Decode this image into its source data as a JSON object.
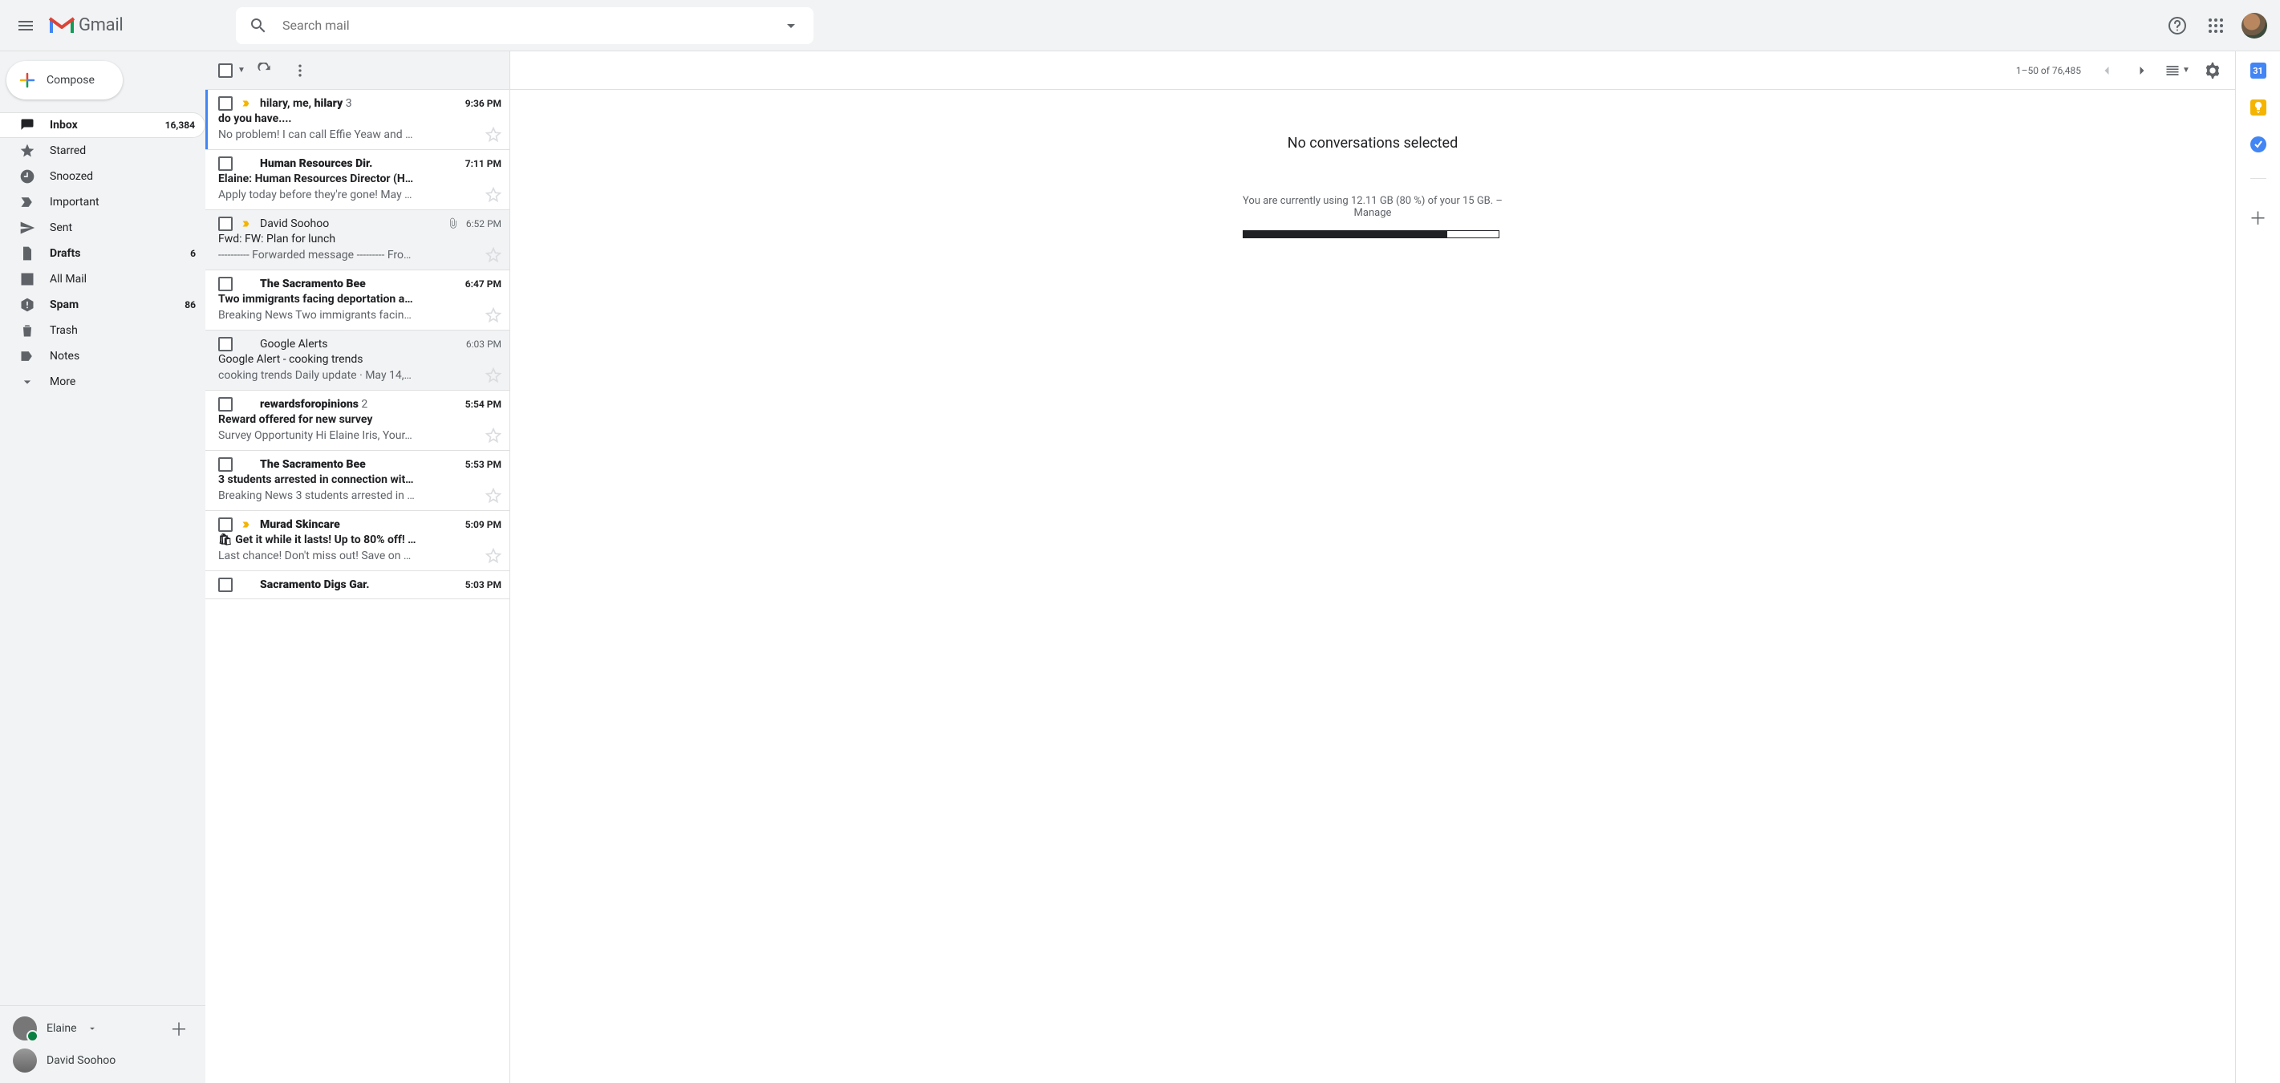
{
  "header": {
    "app_name": "Gmail",
    "search_placeholder": "Search mail"
  },
  "compose_label": "Compose",
  "sidebar": {
    "items": [
      {
        "icon": "inbox",
        "label": "Inbox",
        "count": "16,384",
        "active": true,
        "bold": true
      },
      {
        "icon": "star",
        "label": "Starred",
        "count": "",
        "active": false,
        "bold": false
      },
      {
        "icon": "clock",
        "label": "Snoozed",
        "count": "",
        "active": false,
        "bold": false
      },
      {
        "icon": "important",
        "label": "Important",
        "count": "",
        "active": false,
        "bold": false
      },
      {
        "icon": "send",
        "label": "Sent",
        "count": "",
        "active": false,
        "bold": false
      },
      {
        "icon": "file",
        "label": "Drafts",
        "count": "6",
        "active": false,
        "bold": true
      },
      {
        "icon": "mail",
        "label": "All Mail",
        "count": "",
        "active": false,
        "bold": false
      },
      {
        "icon": "spam",
        "label": "Spam",
        "count": "86",
        "active": false,
        "bold": true
      },
      {
        "icon": "trash",
        "label": "Trash",
        "count": "",
        "active": false,
        "bold": false
      },
      {
        "icon": "label",
        "label": "Notes",
        "count": "",
        "active": false,
        "bold": false
      },
      {
        "icon": "expand",
        "label": "More",
        "count": "",
        "active": false,
        "bold": false
      }
    ]
  },
  "hangouts": {
    "me": "Elaine",
    "contacts": [
      "David Soohoo"
    ]
  },
  "toolbar": {
    "page_info": "1–50 of 76,485"
  },
  "conversations": [
    {
      "unread": true,
      "selected": true,
      "important": true,
      "attachment": false,
      "sender_html": "hilary, me, <b>hilary</b>",
      "thread_count": "3",
      "time": "9:36 PM",
      "subject": "do you have....",
      "snippet": "No problem! I can call Effie Yeaw and …"
    },
    {
      "unread": true,
      "selected": false,
      "important": false,
      "attachment": false,
      "sender_html": "<b>Human Resources Dir.</b>",
      "thread_count": "",
      "time": "7:11 PM",
      "subject": "Elaine: Human Resources Director (H…",
      "snippet": "Apply today before they're gone! May …"
    },
    {
      "unread": false,
      "selected": false,
      "important": true,
      "attachment": true,
      "sender_html": "David Soohoo",
      "thread_count": "",
      "time": "6:52 PM",
      "subject": "Fwd: FW: Plan for lunch",
      "snippet": "---------- Forwarded message --------- Fro…"
    },
    {
      "unread": true,
      "selected": false,
      "important": false,
      "attachment": false,
      "sender_html": "<b>The Sacramento Bee</b>",
      "thread_count": "",
      "time": "6:47 PM",
      "subject": "Two immigrants facing deportation a…",
      "snippet": "Breaking News Two immigrants facin…"
    },
    {
      "unread": false,
      "selected": false,
      "important": false,
      "attachment": false,
      "sender_html": "Google Alerts",
      "thread_count": "",
      "time": "6:03 PM",
      "subject": "Google Alert - cooking trends",
      "snippet": "cooking trends Daily update · May 14,…"
    },
    {
      "unread": true,
      "selected": false,
      "important": false,
      "attachment": false,
      "sender_html": "<b>rewardsforopinions</b>",
      "thread_count": "2",
      "time": "5:54 PM",
      "subject": "Reward offered for new survey",
      "snippet": "Survey Opportunity Hi Elaine Iris, Your…"
    },
    {
      "unread": true,
      "selected": false,
      "important": false,
      "attachment": false,
      "sender_html": "<b>The Sacramento Bee</b>",
      "thread_count": "",
      "time": "5:53 PM",
      "subject": "3 students arrested in connection wit…",
      "snippet": "Breaking News 3 students arrested in …"
    },
    {
      "unread": true,
      "selected": false,
      "important": true,
      "attachment": false,
      "sender_html": "<b>Murad Skincare</b>",
      "thread_count": "",
      "time": "5:09 PM",
      "subject": "🛍 Get it while it lasts! Up to 80% off! …",
      "snippet": "Last chance! Don't miss out! Save on …"
    },
    {
      "unread": true,
      "selected": false,
      "important": false,
      "attachment": false,
      "sender_html": "<b>Sacramento Digs Gar.</b>",
      "thread_count": "",
      "time": "5:03 PM",
      "subject": "",
      "snippet": ""
    }
  ],
  "reading": {
    "empty_title": "No conversations selected",
    "storage_line": "You are currently using 12.11 GB (80 %) of your 15 GB. –",
    "manage_label": "Manage",
    "storage_percent": 80
  },
  "sidepanel": {
    "calendar": "31"
  }
}
